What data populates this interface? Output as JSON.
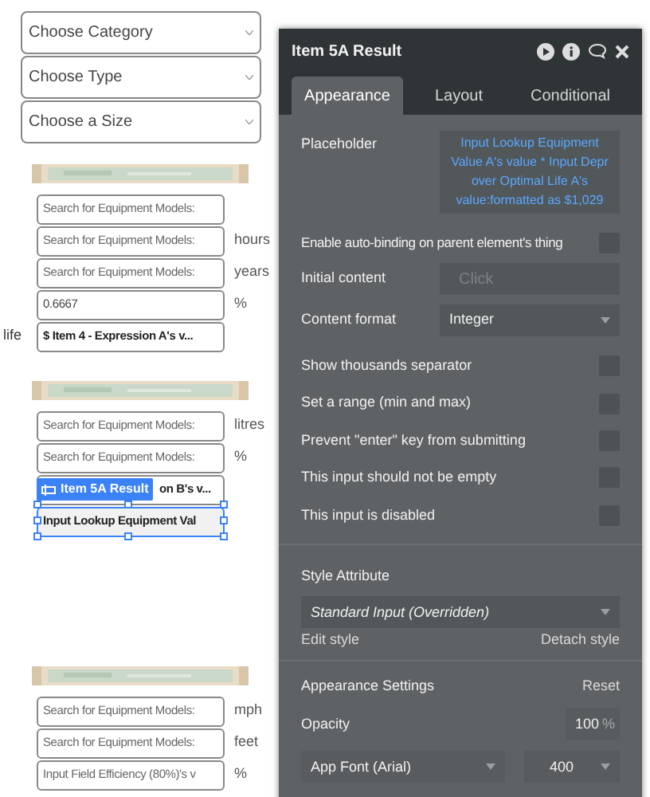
{
  "canvas": {
    "dropdowns": [
      {
        "placeholder": "Choose Category"
      },
      {
        "placeholder": "Choose Type"
      },
      {
        "placeholder": "Choose a Size"
      }
    ],
    "blocks": [
      {
        "inputs": [
          {
            "kind": "placeholder",
            "text": "Search for Equipment Models:",
            "selected": false,
            "covered": false
          },
          {
            "kind": "placeholder",
            "text": "Search for Equipment Models:",
            "unit": "hours",
            "selected": false,
            "covered": false
          },
          {
            "kind": "placeholder",
            "text": "Search for Equipment Models:",
            "unit": "years",
            "selected": false,
            "covered": false
          },
          {
            "kind": "value",
            "text": "0.6667",
            "unit": "%",
            "selected": false,
            "covered": false
          },
          {
            "kind": "dynamic",
            "text": "$ Item 4 - Expression A's v...",
            "side_label": "life",
            "selected": false,
            "covered": false
          }
        ]
      },
      {
        "inputs": [
          {
            "kind": "placeholder",
            "text": "Search for Equipment Models:",
            "unit": "litres",
            "selected": false,
            "covered": false
          },
          {
            "kind": "placeholder",
            "text": "Search for Equipment Models:",
            "unit": "%",
            "selected": false,
            "covered": false
          },
          {
            "kind": "dynamic",
            "text": "on B's v...",
            "selected": false,
            "covered": true
          },
          {
            "kind": "dynamic",
            "text": "Input Lookup Equipment Val",
            "selected": true,
            "covered": false,
            "badge": "Item 5A Result"
          }
        ]
      },
      {
        "inputs": [
          {
            "kind": "placeholder",
            "text": "Search for Equipment Models:",
            "unit": "mph",
            "selected": false,
            "covered": false
          },
          {
            "kind": "placeholder",
            "text": "Search for Equipment Models:",
            "unit": "feet",
            "selected": false,
            "covered": false
          },
          {
            "kind": "placeholder",
            "text": "Input Field Efficiency (80%)'s v",
            "unit": "%",
            "selected": false,
            "covered": false
          }
        ]
      }
    ]
  },
  "panel": {
    "title": "Item 5A Result",
    "tabs": [
      {
        "label": "Appearance",
        "selected": true
      },
      {
        "label": "Layout",
        "selected": false
      },
      {
        "label": "Conditional",
        "selected": false
      }
    ],
    "placeholder": {
      "label": "Placeholder",
      "value": "Input Lookup Equipment Value A's value * Input Depr over Optimal Life A's value:formatted as $1,029"
    },
    "auto_binding": {
      "label": "Enable auto-binding on parent element's thing",
      "checked": false
    },
    "initial_content": {
      "label": "Initial content",
      "placeholder": "Click"
    },
    "content_format": {
      "label": "Content format",
      "value": "Integer"
    },
    "options": [
      {
        "label": "Show thousands separator",
        "checked": false
      },
      {
        "label": "Set a range (min and max)",
        "checked": false
      },
      {
        "label": "Prevent \"enter\" key from submitting",
        "checked": false
      },
      {
        "label": "This input should not be empty",
        "checked": false
      },
      {
        "label": "This input is disabled",
        "checked": false
      }
    ],
    "style": {
      "label": "Style Attribute",
      "value": "Standard Input (Overridden)",
      "edit": "Edit style",
      "detach": "Detach style"
    },
    "appearance": {
      "label": "Appearance Settings",
      "reset": "Reset",
      "opacity_label": "Opacity",
      "opacity": "100",
      "opacity_unit": "%",
      "font": "App Font (Arial)",
      "weight": "400"
    }
  }
}
